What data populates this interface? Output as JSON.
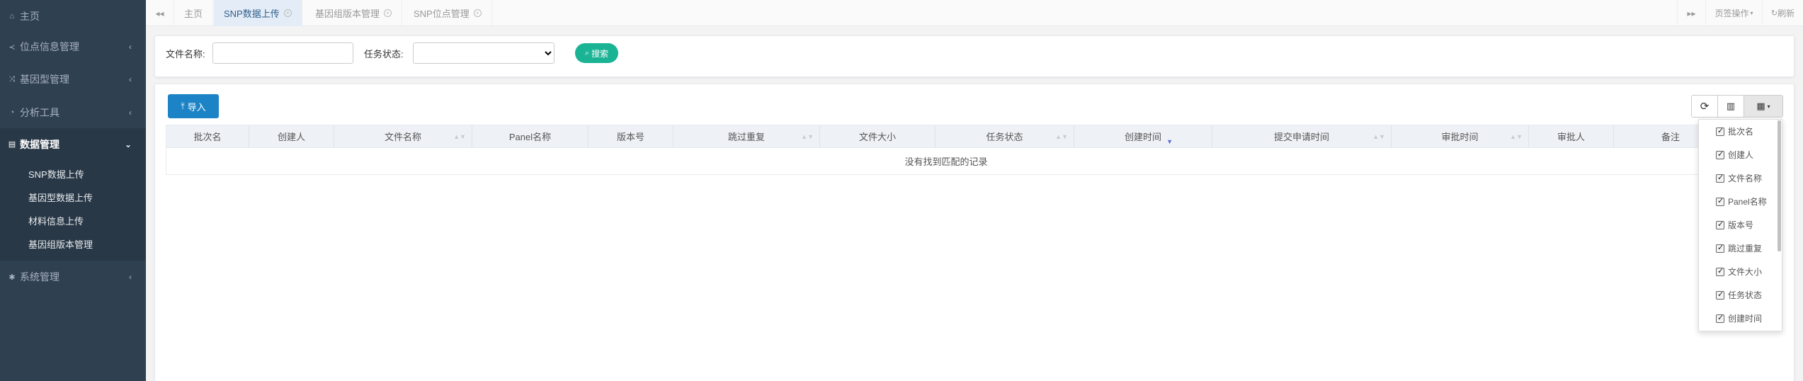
{
  "sidebar": {
    "items": [
      {
        "label": "主页",
        "icon": "home-icon",
        "chevron": ""
      },
      {
        "label": "位点信息管理",
        "icon": "share-icon",
        "chevron": "‹"
      },
      {
        "label": "基因型管理",
        "icon": "shuffle-icon",
        "chevron": "‹"
      },
      {
        "label": "分析工具",
        "icon": "chart-icon",
        "chevron": "‹"
      },
      {
        "label": "数据管理",
        "icon": "database-icon",
        "chevron": "⌄"
      },
      {
        "label": "系统管理",
        "icon": "gear-icon",
        "chevron": "‹"
      }
    ],
    "subitems": [
      "SNP数据上传",
      "基因型数据上传",
      "材料信息上传",
      "基因组版本管理"
    ]
  },
  "tabbar": {
    "back_icon": "double-left-icon",
    "forward_icon": "double-right-icon",
    "tabs": [
      {
        "label": "主页",
        "closable": false,
        "active": false
      },
      {
        "label": "SNP数据上传",
        "closable": true,
        "active": true
      },
      {
        "label": "基因组版本管理",
        "closable": true,
        "active": false
      },
      {
        "label": "SNP位点管理",
        "closable": true,
        "active": false
      }
    ],
    "page_ops": "页签操作",
    "refresh": "刷新"
  },
  "search": {
    "file_name_label": "文件名称:",
    "file_name_value": "",
    "task_status_label": "任务状态:",
    "task_status_value": "",
    "search_button": "搜索"
  },
  "toolbar": {
    "import_button": "导入",
    "refresh_icon": "refresh-icon",
    "toggle_view_icon": "list-view-icon",
    "columns_icon": "grid-icon"
  },
  "table": {
    "headers": [
      {
        "label": "批次名",
        "sortable": false
      },
      {
        "label": "创建人",
        "sortable": false
      },
      {
        "label": "文件名称",
        "sortable": true
      },
      {
        "label": "Panel名称",
        "sortable": false
      },
      {
        "label": "版本号",
        "sortable": false
      },
      {
        "label": "跳过重复",
        "sortable": true
      },
      {
        "label": "文件大小",
        "sortable": false
      },
      {
        "label": "任务状态",
        "sortable": true
      },
      {
        "label": "创建时间",
        "sortable": true,
        "sorted": "desc"
      },
      {
        "label": "提交申请时间",
        "sortable": true
      },
      {
        "label": "审批时间",
        "sortable": true
      },
      {
        "label": "审批人",
        "sortable": false
      },
      {
        "label": "备注",
        "sortable": true
      }
    ],
    "empty_text": "没有找到匹配的记录"
  },
  "columns_dropdown": {
    "items": [
      {
        "label": "批次名",
        "checked": true
      },
      {
        "label": "创建人",
        "checked": true
      },
      {
        "label": "文件名称",
        "checked": true
      },
      {
        "label": "Panel名称",
        "checked": true
      },
      {
        "label": "版本号",
        "checked": true
      },
      {
        "label": "跳过重复",
        "checked": true
      },
      {
        "label": "文件大小",
        "checked": true
      },
      {
        "label": "任务状态",
        "checked": true
      },
      {
        "label": "创建时间",
        "checked": true
      }
    ]
  },
  "colors": {
    "sidebar_bg": "#2f4050",
    "search_button": "#1ab394",
    "import_button": "#1c84c6",
    "active_tab_bg": "#e4edf7"
  }
}
